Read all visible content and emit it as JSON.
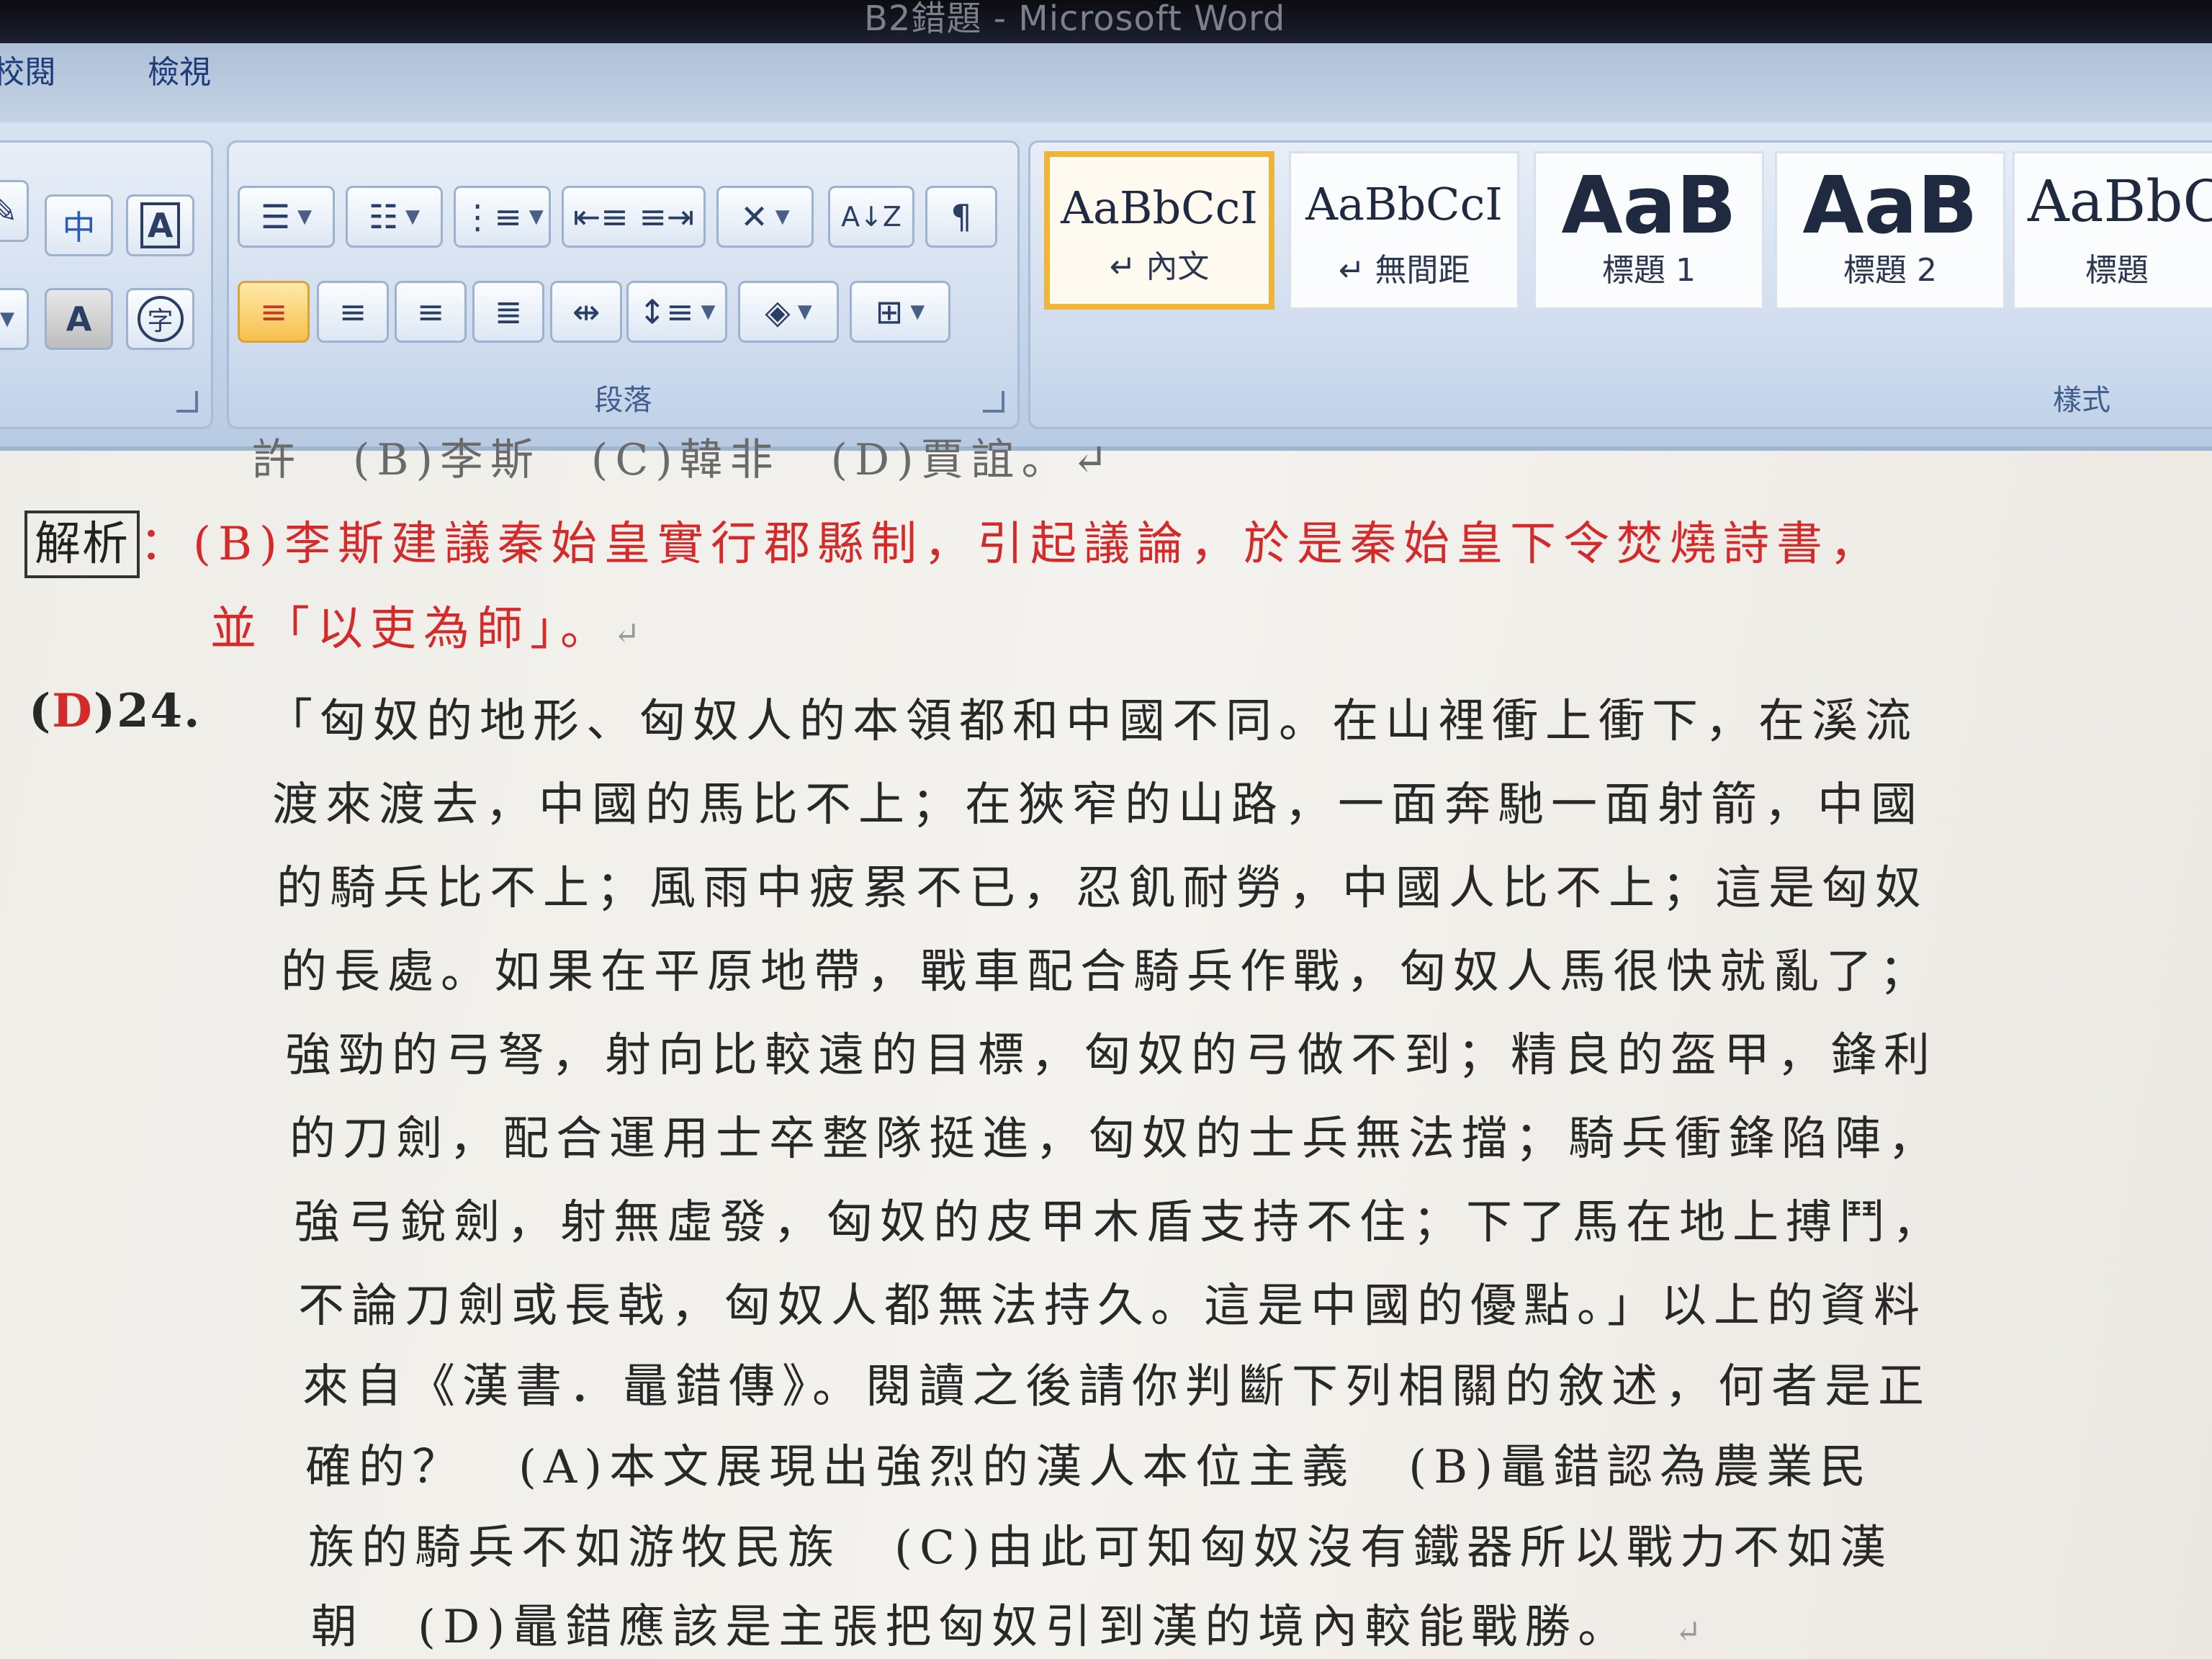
{
  "window": {
    "title": "B2錯題 - Microsoft Word"
  },
  "ribbon_tabs": [
    "校閱",
    "檢視"
  ],
  "ribbon": {
    "font_group": {
      "buttons": [
        "中",
        "A",
        "A",
        "字"
      ]
    },
    "paragraph_group": {
      "label": "段落",
      "sort_label": "A↓Z"
    },
    "styles_group": {
      "label": "樣式",
      "styles": [
        {
          "sample": "AaBbCcI",
          "name": "↵ 內文",
          "selected": true
        },
        {
          "sample": "AaBbCcI",
          "name": "↵ 無間距",
          "selected": false
        },
        {
          "sample": "AaB",
          "name": "標題 1",
          "selected": false
        },
        {
          "sample": "AaB",
          "name": "標題 2",
          "selected": false
        },
        {
          "sample": "AaBbC",
          "name": "標題",
          "selected": false
        }
      ]
    }
  },
  "document": {
    "cut_line": "許　(B)李斯　(C)韓非　(D)賈誼。↵",
    "analysis_label": "解析",
    "analysis_lines": [
      "：(B)李斯建議秦始皇實行郡縣制，引起議論，於是秦始皇下令焚燒詩書，",
      "並「以吏為師」。"
    ],
    "question": {
      "answer": "D",
      "number": "24.",
      "lines": [
        "「匈奴的地形、匈奴人的本領都和中國不同。在山裡衝上衝下，在溪流",
        "渡來渡去，中國的馬比不上；在狹窄的山路，一面奔馳一面射箭，中國",
        "的騎兵比不上；風雨中疲累不已，忍飢耐勞，中國人比不上；這是匈奴",
        "的長處。如果在平原地帶，戰車配合騎兵作戰，匈奴人馬很快就亂了；",
        "強勁的弓弩，射向比較遠的目標，匈奴的弓做不到；精良的盔甲，鋒利",
        "的刀劍，配合運用士卒整隊挺進，匈奴的士兵無法擋；騎兵衝鋒陷陣，",
        "強弓銳劍，射無虛發，匈奴的皮甲木盾支持不住；下了馬在地上搏鬥，",
        "不論刀劍或長戟，匈奴人都無法持久。這是中國的優點。」以上的資料",
        "來自《漢書．鼂錯傳》。閱讀之後請你判斷下列相關的敘述，何者是正",
        "確的？　(A)本文展現出強烈的漢人本位主義　(B)鼂錯認為農業民",
        "族的騎兵不如游牧民族　(C)由此可知匈奴沒有鐵器所以戰力不如漢",
        "朝　(D)鼂錯應該是主張把匈奴引到漢的境內較能戰勝。"
      ]
    },
    "paragraph_mark": "↵"
  }
}
